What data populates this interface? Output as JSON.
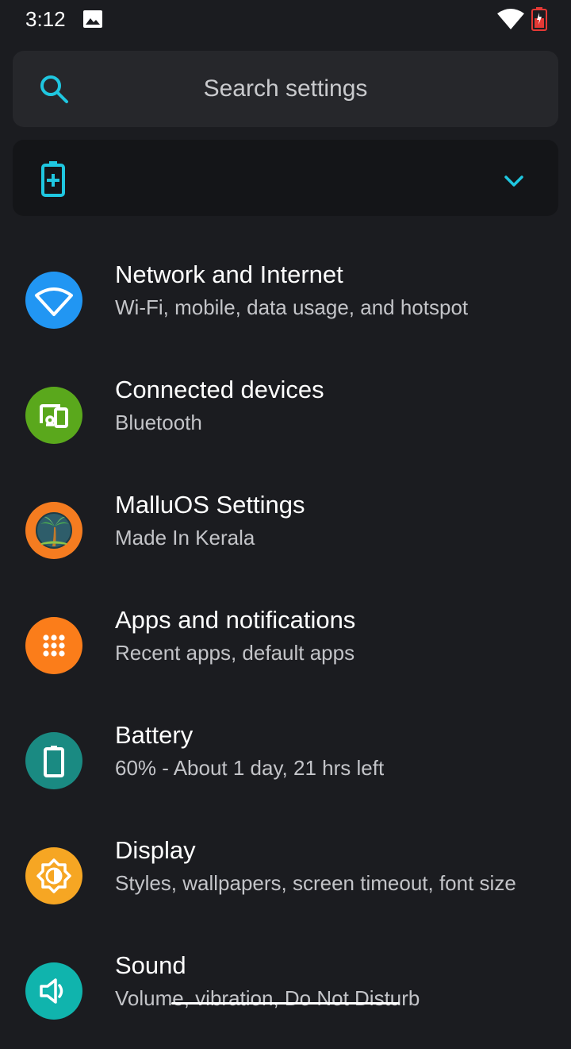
{
  "status_bar": {
    "time": "3:12",
    "gallery_icon": "image-icon",
    "wifi_icon": "wifi-icon",
    "battery_icon": "battery-icon"
  },
  "search": {
    "placeholder": "Search settings",
    "icon": "search-icon"
  },
  "suggestion": {
    "icon": "battery-saver-icon",
    "expand_icon": "chevron-down-icon"
  },
  "colors": {
    "background": "#1b1c20",
    "accent": "#1fc7e0",
    "network": "#2196f3",
    "connected": "#5aa81c",
    "malluos": "#f57c20",
    "apps": "#fb7d1a",
    "battery": "#1a8a82",
    "display": "#f6a623",
    "sound": "#10b4ad"
  },
  "settings": [
    {
      "title": "Network and Internet",
      "subtitle": "Wi-Fi, mobile, data usage, and hotspot",
      "icon": "wifi-icon"
    },
    {
      "title": "Connected devices",
      "subtitle": "Bluetooth",
      "icon": "devices-icon"
    },
    {
      "title": "MalluOS Settings",
      "subtitle": "Made In Kerala",
      "icon": "palm-tree-icon"
    },
    {
      "title": "Apps and notifications",
      "subtitle": "Recent apps, default apps",
      "icon": "apps-grid-icon"
    },
    {
      "title": "Battery",
      "subtitle": "60% - About 1 day, 21 hrs left",
      "icon": "battery-icon"
    },
    {
      "title": "Display",
      "subtitle": "Styles, wallpapers, screen timeout, font size",
      "icon": "brightness-icon"
    },
    {
      "title": "Sound",
      "subtitle": "Volume, vibration, Do Not Disturb",
      "icon": "volume-icon"
    }
  ]
}
